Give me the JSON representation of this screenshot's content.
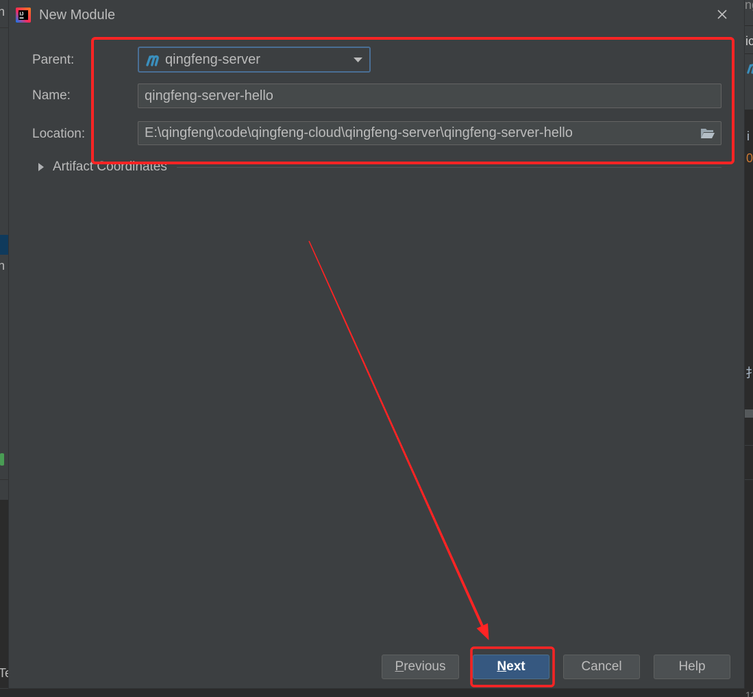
{
  "dialog": {
    "title": "New Module",
    "logo_text": "IJ",
    "logo_icon": "intellij-logo-icon",
    "close_icon": "close-icon"
  },
  "form": {
    "parent": {
      "label": "Parent:",
      "value": "qingfeng-server",
      "icon": "maven-icon",
      "dropdown_icon": "chevron-down-icon"
    },
    "name": {
      "label": "Name:",
      "value": "qingfeng-server-hello"
    },
    "location": {
      "label": "Location:",
      "value": "E:\\qingfeng\\code\\qingfeng-cloud\\qingfeng-server\\qingfeng-server-hello",
      "browse_icon": "folder-icon"
    }
  },
  "artifact_coordinates": {
    "label": "Artifact Coordinates",
    "expanded": false,
    "toggle_icon": "chevron-right-icon"
  },
  "buttons": {
    "previous": "Previous",
    "next": "Next",
    "cancel": "Cancel",
    "help": "Help"
  },
  "background_ide": {
    "left_fragments": [
      "n",
      "n",
      "Te"
    ],
    "right_fragments": [
      "ng",
      "ic",
      "i",
      "0",
      "扌",
      "12"
    ]
  },
  "theme": {
    "accent": "#365880",
    "annotation": "#ff2424",
    "maven": "#3a8fbd"
  }
}
